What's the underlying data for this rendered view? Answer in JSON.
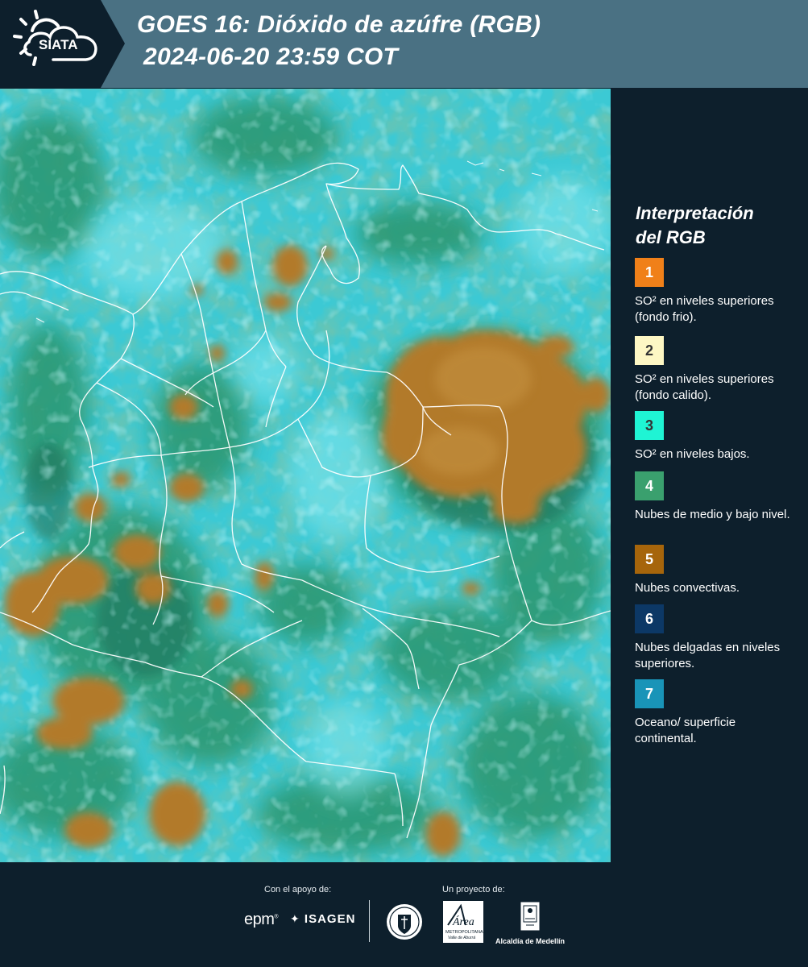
{
  "header": {
    "logo_text": "SIATA",
    "title_line1": "GOES 16: Dióxido de azúfre (RGB)",
    "title_line2": "2024-06-20 23:59 COT"
  },
  "legend": {
    "title_line1": "Interpretación",
    "title_line2": "del RGB",
    "items": [
      {
        "number": "1",
        "color": "#f08019",
        "text_color": "#ffffff",
        "label": "SO² en niveles superiores (fondo frio)."
      },
      {
        "number": "2",
        "color": "#fdf7c4",
        "text_color": "#333333",
        "label": "SO² en niveles superiores (fondo calido)."
      },
      {
        "number": "3",
        "color": "#1ff4d4",
        "text_color": "#333333",
        "label": "SO² en niveles bajos."
      },
      {
        "number": "4",
        "color": "#3aa06e",
        "text_color": "#ffffff",
        "label": "Nubes de medio y bajo nivel."
      },
      {
        "number": "5",
        "color": "#a6650b",
        "text_color": "#ffffff",
        "label": "Nubes convectivas."
      },
      {
        "number": "6",
        "color": "#0c3866",
        "text_color": "#ffffff",
        "label": "Nubes delgadas en niveles superiores."
      },
      {
        "number": "7",
        "color": "#1994b8",
        "text_color": "#ffffff",
        "label": "Oceano/ superficie continental."
      }
    ]
  },
  "footer": {
    "support_label": "Con el apoyo de:",
    "project_label": "Un proyecto de:",
    "epm_text": "epm",
    "isagen_text": "ISAGEN",
    "area_text": "Área",
    "area_sub1": "METROPOLITANA",
    "area_sub2": "Valle de Aburrá",
    "alcaldia_text": "Alcaldía de Medellín"
  },
  "colors": {
    "header_bg": "#4a7183",
    "panel_bg": "#0d1f2c",
    "map_cyan": "#38c9d6",
    "map_green": "#2b9a74",
    "map_brown": "#b57d2a"
  }
}
